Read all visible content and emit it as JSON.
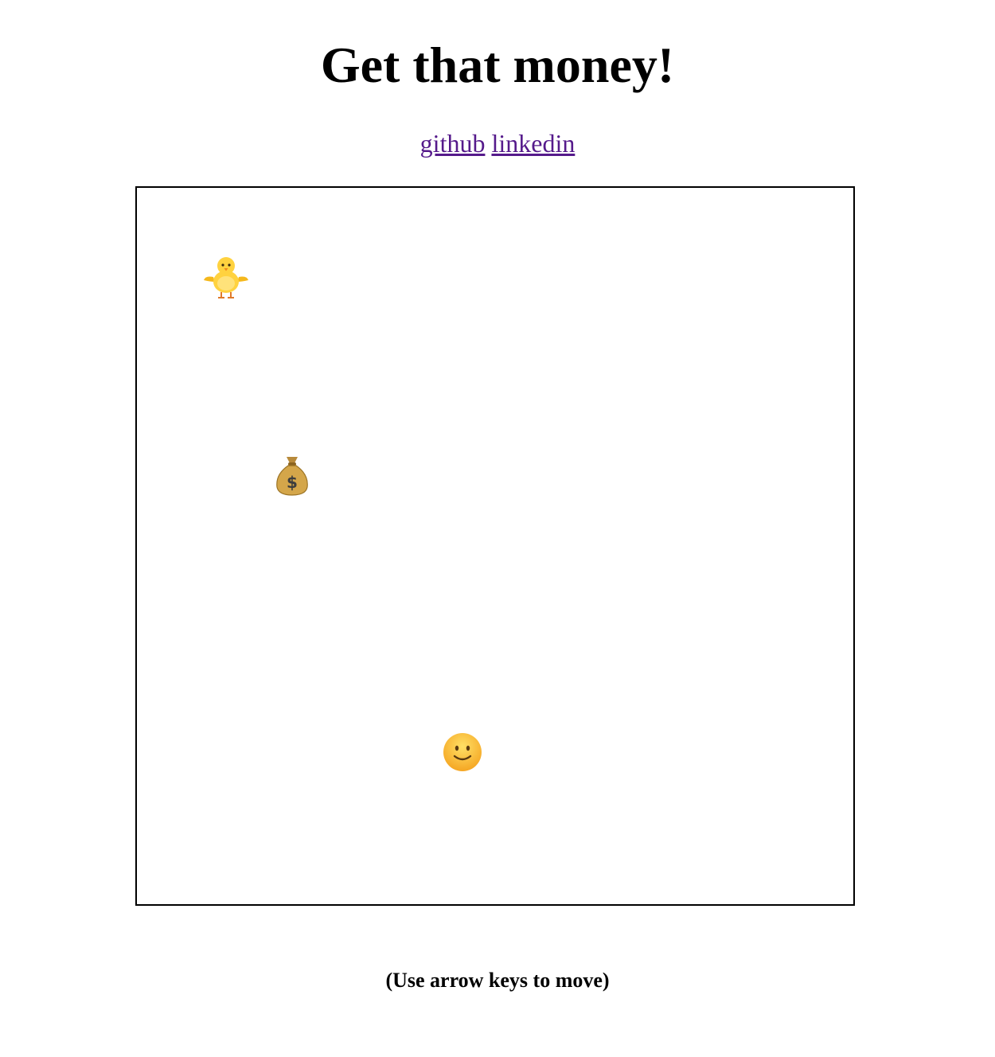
{
  "header": {
    "title": "Get that money!"
  },
  "links": [
    {
      "label": "github"
    },
    {
      "label": "linkedin"
    }
  ],
  "board": {
    "sprites": [
      {
        "name": "chick",
        "icon": "front-facing-baby-chick-icon"
      },
      {
        "name": "money-bag",
        "icon": "money-bag-icon"
      },
      {
        "name": "player",
        "icon": "slightly-smiling-face-icon"
      }
    ]
  },
  "footer": {
    "instructions": "(Use arrow keys to move)"
  },
  "colors": {
    "link": "#551a8b",
    "border": "#000000",
    "background": "#ffffff"
  }
}
